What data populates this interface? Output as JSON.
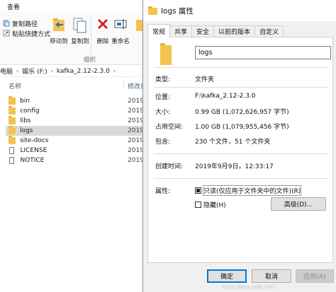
{
  "explorer": {
    "menu_view": "查看",
    "ribbon": {
      "copy_path": "复制路径",
      "paste_shortcut": "粘贴快捷方式",
      "move_to": "移动到",
      "copy_to": "复制到",
      "delete": "删除",
      "rename": "重命名",
      "group_label": "组织"
    },
    "breadcrumb": [
      "电脑",
      "娱乐 (F:)",
      "kafka_2.12-2.3.0"
    ],
    "columns": {
      "name": "名称",
      "modified": "修改日"
    },
    "files": [
      {
        "name": "bin",
        "type": "folder",
        "date": "2019/"
      },
      {
        "name": "config",
        "type": "folder",
        "date": "2019/"
      },
      {
        "name": "libs",
        "type": "folder",
        "date": "2019/"
      },
      {
        "name": "logs",
        "type": "folder",
        "date": "2019/",
        "selected": true
      },
      {
        "name": "site-docs",
        "type": "folder",
        "date": "2019/"
      },
      {
        "name": "LICENSE",
        "type": "file",
        "date": "2019/"
      },
      {
        "name": "NOTICE",
        "type": "file",
        "date": "2019/"
      }
    ]
  },
  "dialog": {
    "title": "logs 属性",
    "tabs": [
      "常规",
      "共享",
      "安全",
      "以前的版本",
      "自定义"
    ],
    "active_tab": "常规",
    "folder_name": "logs",
    "props": {
      "type_label": "类型:",
      "type_value": "文件夹",
      "location_label": "位置:",
      "location_value": "F:\\kafka_2.12-2.3.0",
      "size_label": "大小:",
      "size_value": "0.99 GB (1,072,626,957 字节)",
      "disk_label": "占用空间:",
      "disk_value": "1.00 GB (1,079,955,456 字节)",
      "contains_label": "包含:",
      "contains_value": "230 个文件，51 个文件夹",
      "created_label": "创建时间:",
      "created_value": "2019年9月9日，12:33:17",
      "attr_label": "属性:"
    },
    "readonly_label": "只读(仅应用于文件夹中的文件)(R)",
    "hidden_label": "隐藏(H)",
    "advanced_button": "高级(D)...",
    "ok_button": "确定",
    "cancel_button": "取消",
    "apply_button": "应用(A)"
  },
  "watermark": "https://blog.csdn.net/…"
}
